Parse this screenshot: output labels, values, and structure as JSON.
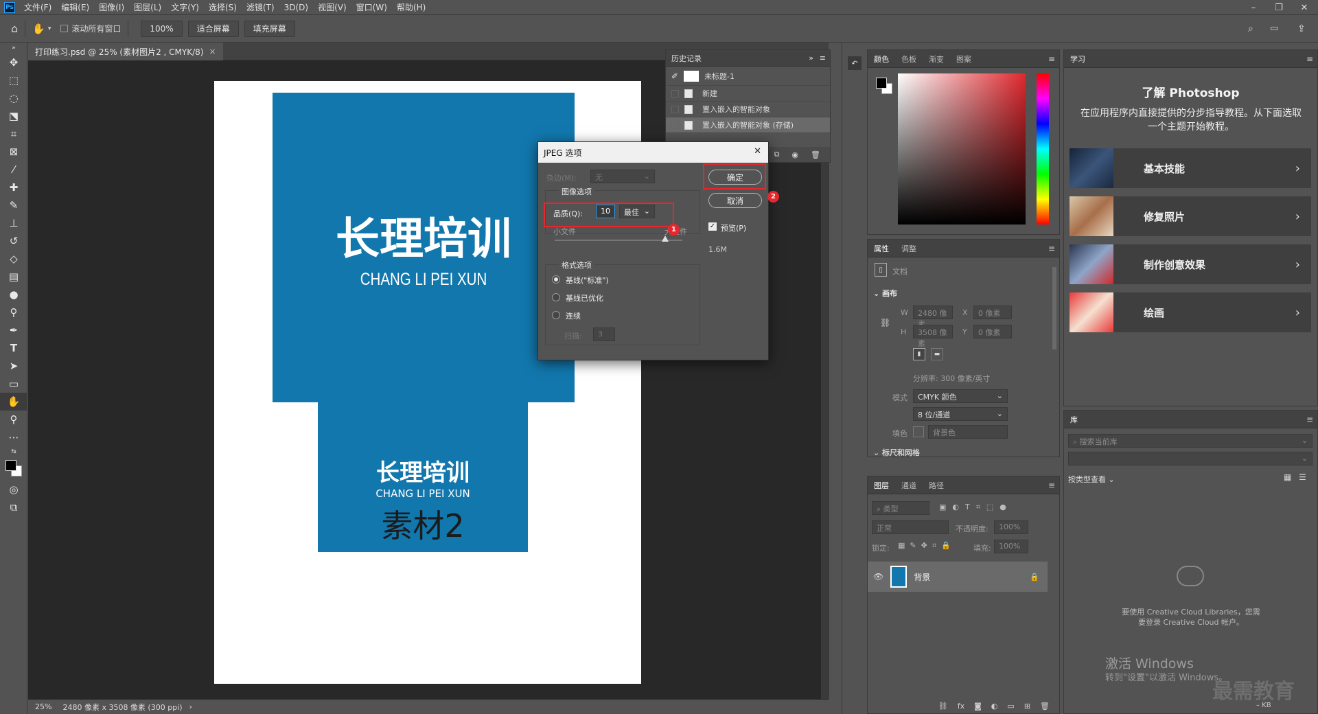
{
  "app": {
    "logo": "Ps",
    "menu": [
      "文件(F)",
      "编辑(E)",
      "图像(I)",
      "图层(L)",
      "文字(Y)",
      "选择(S)",
      "滤镜(T)",
      "3D(D)",
      "视图(V)",
      "窗口(W)",
      "帮助(H)"
    ],
    "window_controls": [
      "–",
      "❐",
      "✕"
    ]
  },
  "options_bar": {
    "scroll_all_label": "滚动所有窗口",
    "zoom_value": "100%",
    "fit_screen_label": "适合屏幕",
    "fill_screen_label": "填充屏幕"
  },
  "document": {
    "tab_title": "打印练习.psd @ 25% (素材图片2 , CMYK/8)",
    "tab_close": "×",
    "canvas_text_big": "长理培训",
    "canvas_text_pinyin": "CHANG LI PEI XUN",
    "canvas_text_small": "长理培训",
    "canvas_text_pinyin2": "CHANG LI PEI XUN",
    "canvas_text_material": "素材2",
    "status_zoom": "25%",
    "status_info": "2480 像素 x 3508 像素 (300 ppi)"
  },
  "history": {
    "title": "历史记录",
    "snapshot": "未标题-1",
    "items": [
      "新建",
      "置入嵌入的智能对象",
      "置入嵌入的智能对象 (存储)"
    ]
  },
  "color_panel": {
    "tabs": [
      "颜色",
      "色板",
      "渐变",
      "图案"
    ]
  },
  "properties": {
    "tabs": [
      "属性",
      "调整"
    ],
    "doc_label": "文档",
    "canvas_section": "画布",
    "w_label": "W",
    "w_value": "2480 像素",
    "h_label": "H",
    "h_value": "3508 像素",
    "x_label": "X",
    "x_value": "0 像素",
    "y_label": "Y",
    "y_value": "0 像素",
    "resolution": "分辨率: 300 像素/英寸",
    "mode_label": "模式",
    "mode_value": "CMYK 颜色",
    "depth_value": "8 位/通道",
    "fill_label": "填色",
    "fill_value": "背景色",
    "guides_section": "标尺和网格"
  },
  "layers": {
    "tabs": [
      "图层",
      "通道",
      "路径"
    ],
    "filter_kind": "类型",
    "blend_mode": "正常",
    "opacity_label": "不透明度:",
    "opacity_value": "100%",
    "lock_label": "锁定:",
    "fill_label": "填充:",
    "fill_value": "100%",
    "layer_name": "背景"
  },
  "learn": {
    "tab": "学习",
    "title": "了解 Photoshop",
    "description": "在应用程序内直接提供的分步指导教程。从下面选取一个主题开始教程。",
    "cards": [
      {
        "label": "基本技能",
        "color": "#2a3d5c"
      },
      {
        "label": "修复照片",
        "color": "#b59a78"
      },
      {
        "label": "制作创意效果",
        "color": "#4a5e7a"
      },
      {
        "label": "绘画",
        "color": "#c8323a"
      }
    ]
  },
  "library": {
    "tab": "库",
    "search_placeholder": "搜索当前库",
    "view_by": "按类型查看",
    "cc_message": "要使用 Creative Cloud Libraries，您需要登录 Creative Cloud 帐户。",
    "size": "– KB"
  },
  "watermark": {
    "activate_title": "激活 Windows",
    "activate_sub": "转到\"设置\"以激活 Windows。",
    "brand": "最需教育"
  },
  "jpeg_dialog": {
    "title": "JPEG 选项",
    "close": "✕",
    "matte_label": "杂边(M):",
    "matte_value": "无",
    "image_options": "图像选项",
    "quality_label": "品质(Q):",
    "quality_value": "10",
    "quality_preset": "最佳",
    "small_file": "小文件",
    "large_file": "大文件",
    "format_options": "格式选项",
    "format_baseline_std": "基线(\"标准\")",
    "format_baseline_opt": "基线已优化",
    "format_progressive": "连续",
    "scans_label": "扫描:",
    "scans_value": "3",
    "ok_label": "确定",
    "cancel_label": "取消",
    "preview_label": "预览(P)",
    "file_size": "1.6M",
    "annotation_1": "1",
    "annotation_2": "2"
  }
}
